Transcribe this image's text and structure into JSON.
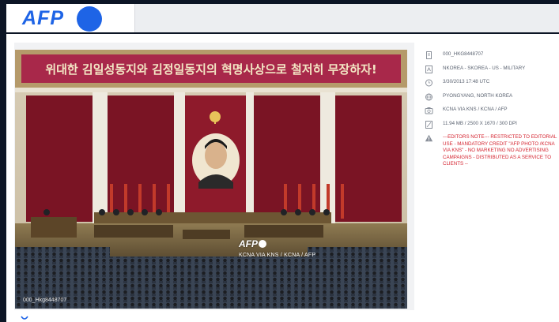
{
  "header": {
    "logo_text": "AFP"
  },
  "photo": {
    "banner_text": "위대한 김일성동지와 김정일동지의 혁명사상으로 철저히 무장하자!",
    "watermark_logo": "AFP",
    "watermark_credit": "KCNA VIA KNS / KCNA / AFP",
    "overlay_id": "000_Hkg8448707"
  },
  "meta": {
    "id": "000_Hkg8448707",
    "keywords": "NKOREA - SKOREA - US - MILITARY",
    "date": "3/30/2013 17:48 UTC",
    "location": "PYONGYANG, NORTH KOREA",
    "credit": "KCNA VIA KNS / KCNA / AFP",
    "size": "11.94 Mb / 2500 x 1670 / 300 dpi",
    "note": "---EDITORS NOTE--- RESTRICTED TO EDITORIAL USE - MANDATORY CREDIT \"AFP PHOTO /KCNA VIA KNS\" - NO MARKETING NO ADVERTISING CAMPAIGNS - DISTRIBUTED AS A SERVICE TO CLIENTS --"
  },
  "colors": {
    "accent": "#1e64e6",
    "note_red": "#d4232f",
    "background": "#0c1525"
  },
  "icons": [
    "image-icon",
    "tag-icon",
    "clock-icon",
    "globe-icon",
    "camera-icon",
    "resize-icon",
    "warning-icon"
  ]
}
